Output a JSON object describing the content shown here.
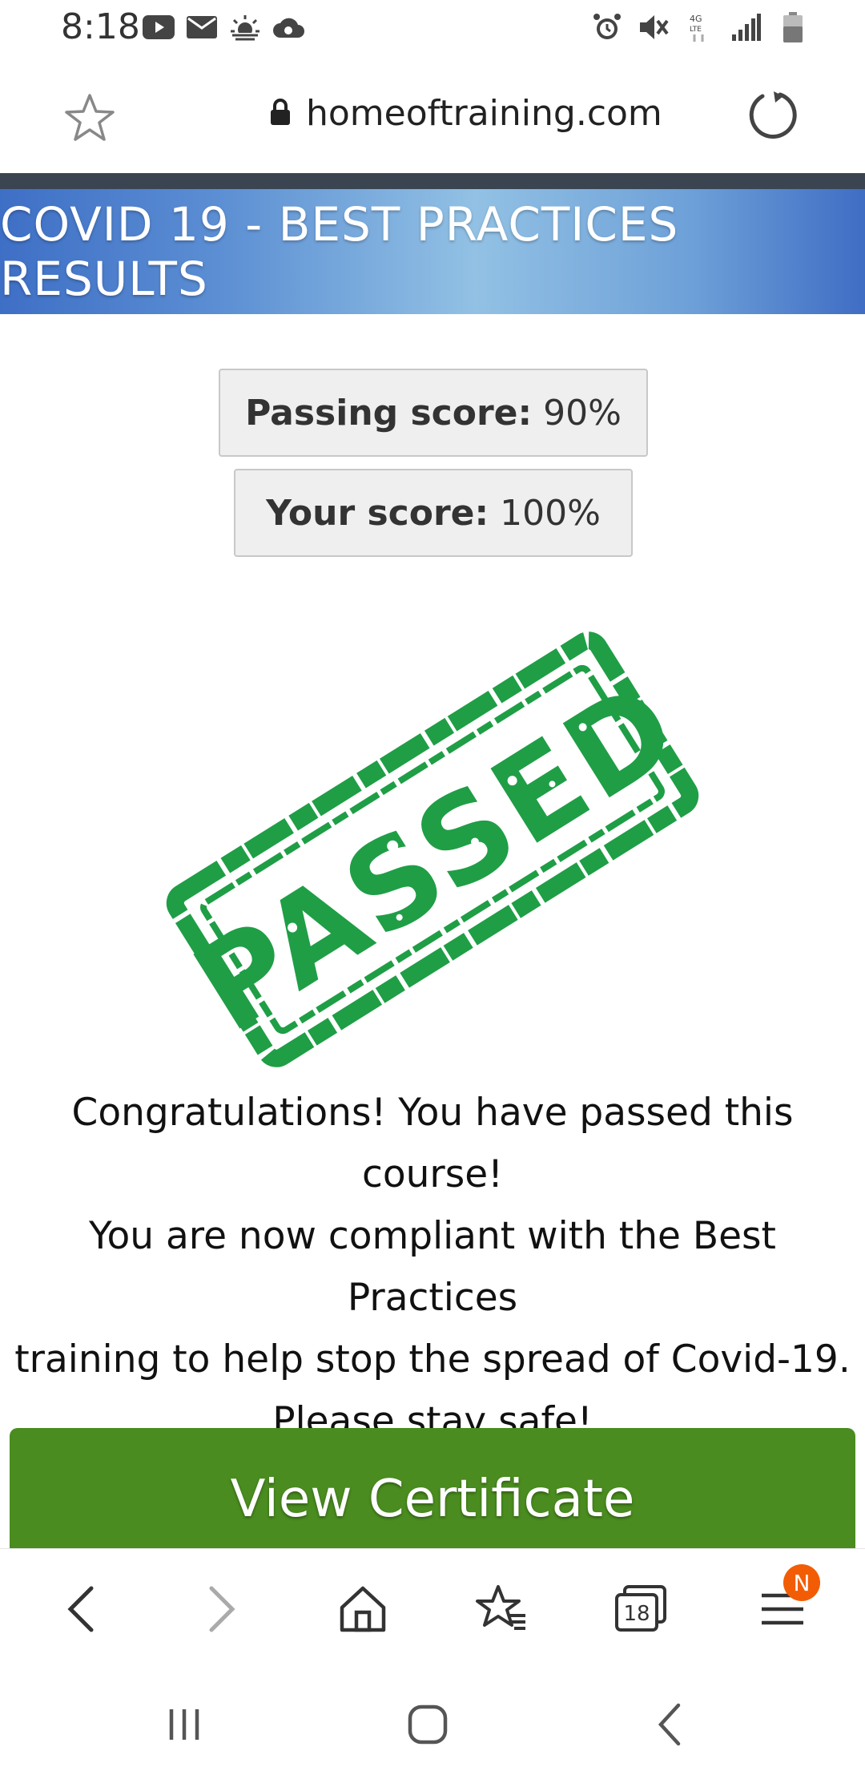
{
  "status_bar": {
    "time": "8:18",
    "left_icons": [
      "youtube-icon",
      "mail-icon",
      "weather-icon",
      "cloud-icon"
    ],
    "right_icons": [
      "alarm-icon",
      "mute-icon",
      "lte-icon",
      "signal-icon",
      "battery-icon"
    ],
    "network_label": "4G LTE"
  },
  "url_bar": {
    "url": "homeoftraining.com",
    "lock_icon": "lock-icon"
  },
  "banner": {
    "title": "COVID 19 - BEST PRACTICES RESULTS"
  },
  "scores": {
    "passing_label": "Passing score:",
    "passing_value": "90%",
    "your_label": "Your score:",
    "your_value": "100%"
  },
  "stamp": {
    "text": "PASSED",
    "color": "#1f9e46"
  },
  "message": {
    "lines": [
      "Congratulations! You have passed this course!",
      "You are now compliant with the Best Practices",
      "training to help stop the spread of Covid-19.",
      "Please stay safe!"
    ]
  },
  "certificate_button": {
    "label": "View Certificate",
    "color": "#4a8c1f"
  },
  "toolbar": {
    "tabs_count": "18",
    "menu_badge": "N"
  },
  "colors": {
    "banner_start": "#3e6fc6",
    "banner_mid": "#92c1e4",
    "dark_strip": "#3b4552",
    "badge": "#f25c05"
  }
}
